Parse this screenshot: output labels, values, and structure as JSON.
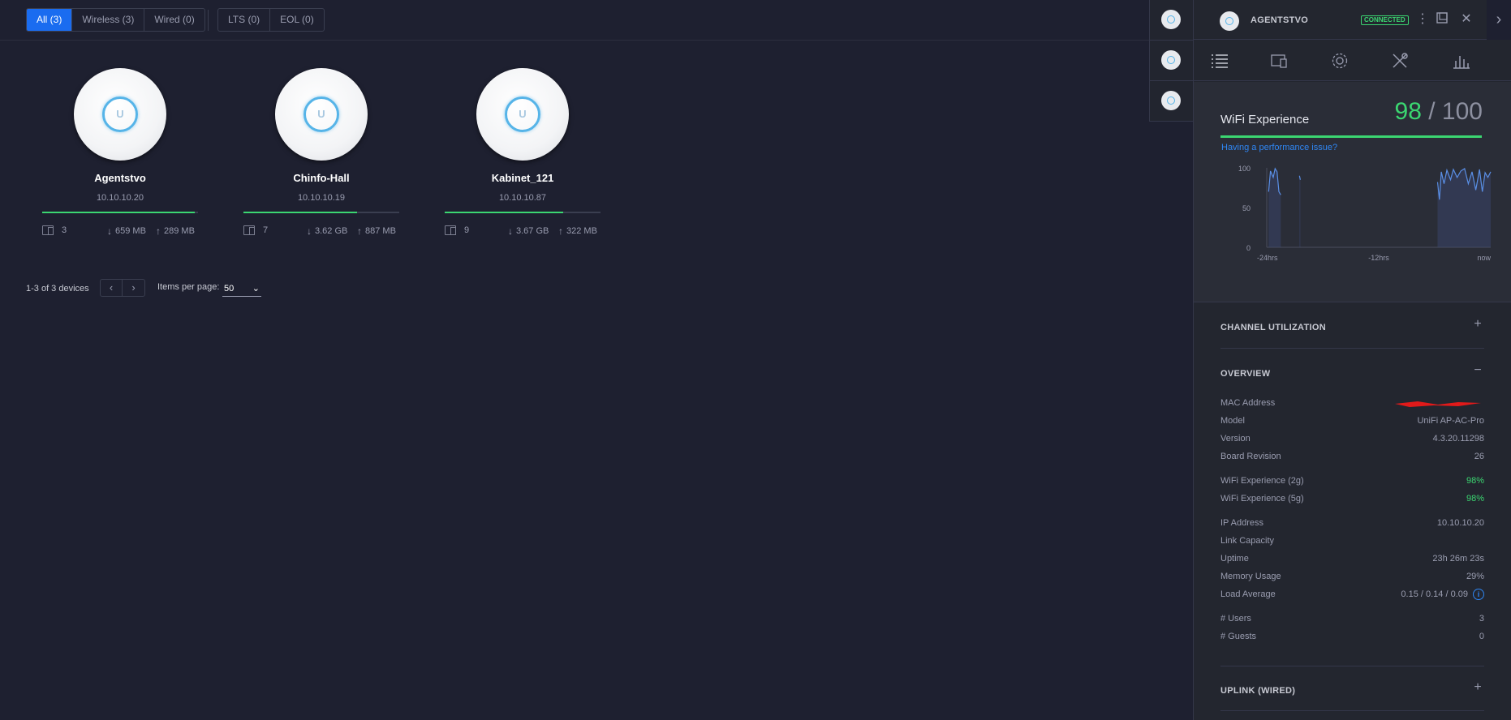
{
  "filters": {
    "all": "All (3)",
    "wireless": "Wireless (3)",
    "wired": "Wired (0)",
    "lts": "LTS (0)",
    "eol": "EOL (0)"
  },
  "devices": [
    {
      "name": "Agentstvo",
      "ip": "10.10.10.20",
      "experience": 98,
      "clients": "3",
      "down": "659 MB",
      "up": "289 MB"
    },
    {
      "name": "Chinfo-Hall",
      "ip": "10.10.10.19",
      "experience": 73,
      "clients": "7",
      "down": "3.62 GB",
      "up": "887 MB"
    },
    {
      "name": "Kabinet_121",
      "ip": "10.10.10.87",
      "experience": 76,
      "clients": "9",
      "down": "3.67 GB",
      "up": "322 MB"
    }
  ],
  "pager": {
    "summary": "1-3 of 3 devices",
    "prev_icon": "chevron-left-icon",
    "next_icon": "chevron-right-icon",
    "items_label": "Items per page:",
    "items_value": "50"
  },
  "panel": {
    "title": "AGENTSTVO",
    "status": "CONNECTED",
    "icons": [
      "more-vertical-icon",
      "window-icon",
      "close-icon"
    ],
    "collapse_icon": "chevron-right-icon",
    "tabs": [
      "list-icon",
      "devices-icon",
      "gear-icon",
      "tools-icon",
      "stats-icon"
    ],
    "wifi": {
      "title": "WiFi Experience",
      "score": "98",
      "max": "/ 100",
      "link": "Having a performance issue?"
    },
    "channel_title": "CHANNEL UTILIZATION",
    "overview_title": "OVERVIEW",
    "uplink_title": "UPLINK (WIRED)",
    "overview": [
      {
        "label": "MAC Address",
        "value": ""
      },
      {
        "label": "Model",
        "value": "UniFi AP-AC-Pro"
      },
      {
        "label": "Version",
        "value": "4.3.20.11298"
      },
      {
        "label": "Board Revision",
        "value": "26"
      },
      {
        "label": "WiFi Experience (2g)",
        "value": "98%"
      },
      {
        "label": "WiFi Experience (5g)",
        "value": "98%"
      },
      {
        "label": "IP Address",
        "value": "10.10.10.20"
      },
      {
        "label": "Link Capacity",
        "value": ""
      },
      {
        "label": "Uptime",
        "value": "23h 26m 23s"
      },
      {
        "label": "Memory Usage",
        "value": "29%"
      },
      {
        "label": "Load Average",
        "value": "0.15 / 0.14 / 0.09"
      },
      {
        "label": "# Users",
        "value": "3"
      },
      {
        "label": "# Guests",
        "value": "0"
      }
    ]
  },
  "colors": {
    "accent": "#1a6cf0",
    "good": "#3bd671",
    "link": "#2f86f3",
    "line": "#5a8fe6"
  },
  "chart_data": {
    "type": "area",
    "title": "",
    "ylim": [
      0,
      100
    ],
    "yticks": [
      "100",
      "50",
      "0"
    ],
    "xticks": [
      "-24hrs",
      "-12hrs",
      "now"
    ],
    "segments": [
      {
        "x": [
          -23.8,
          -23.6,
          -23.3,
          -23.1,
          -22.9,
          -22.7,
          -22.5
        ],
        "y": [
          70,
          96,
          88,
          99,
          95,
          70,
          66
        ]
      },
      {
        "x": [
          -20.5,
          -20.4
        ],
        "y": [
          90,
          85
        ]
      },
      {
        "x": [
          -5.7,
          -5.5,
          -5.3,
          -5.0,
          -4.7,
          -4.3,
          -4.0,
          -3.6,
          -3.2,
          -2.8,
          -2.4,
          -2.0,
          -1.6,
          -1.2,
          -0.9,
          -0.6,
          -0.3,
          0.0
        ],
        "y": [
          82,
          60,
          95,
          80,
          97,
          85,
          98,
          88,
          96,
          99,
          80,
          95,
          72,
          98,
          70,
          94,
          88,
          95
        ]
      }
    ]
  }
}
